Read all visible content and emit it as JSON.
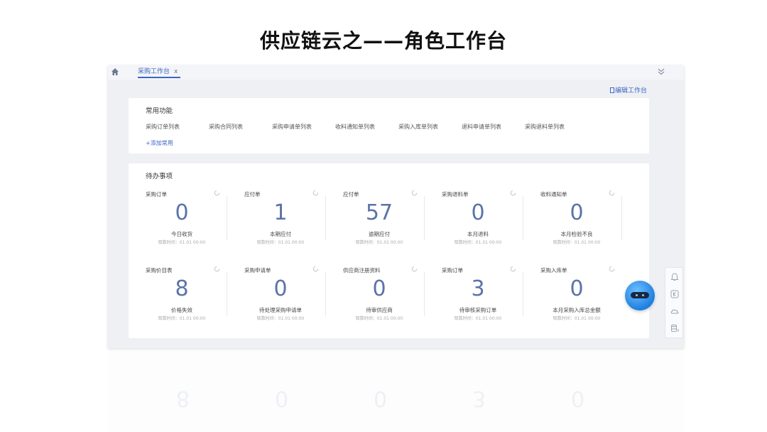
{
  "slide": {
    "title": "供应链云之——角色工作台"
  },
  "tabs": [
    {
      "label": "采购工作台",
      "close": "x"
    }
  ],
  "header": {
    "edit_label": "编辑工作台"
  },
  "frequent": {
    "title": "常用功能",
    "items": [
      "采购订单列表",
      "采购合同列表",
      "采购申请单列表",
      "收料通知单列表",
      "采购入库单列表",
      "退料申请单列表",
      "采购退料单列表"
    ],
    "add_label": "+添加常用"
  },
  "todo": {
    "title": "待办事项",
    "cards": [
      {
        "title": "采购订单",
        "value": "0",
        "label": "今日收货",
        "time": "取数时间：01.01 00:00"
      },
      {
        "title": "应付单",
        "value": "1",
        "label": "本期应付",
        "time": "取数时间：01.01 00:00"
      },
      {
        "title": "应付单",
        "value": "57",
        "label": "逾期应付",
        "time": "取数时间：01.01 00:00"
      },
      {
        "title": "采购退料单",
        "value": "0",
        "label": "本月退料",
        "time": "取数时间：01.01 00:00"
      },
      {
        "title": "收料通知单",
        "value": "0",
        "label": "本月检验不良",
        "time": "取数时间：01.01 00:00"
      },
      {
        "title": "采购价目表",
        "value": "8",
        "label": "价格失效",
        "time": "取数时间：01.01 00:00"
      },
      {
        "title": "采购申请单",
        "value": "0",
        "label": "待处理采购申请单",
        "time": "取数时间：01.01 00:00"
      },
      {
        "title": "供应商注册资料",
        "value": "0",
        "label": "待审供应商",
        "time": "取数时间：01.01 00:00"
      },
      {
        "title": "采购订单",
        "value": "3",
        "label": "待审核采购订单",
        "time": "取数时间：01.01 00:00"
      },
      {
        "title": "采购入库单",
        "value": "0",
        "label": "本月采购入库总金额",
        "time": "取数时间：01.01 00:00"
      }
    ]
  },
  "side_toolbar": {
    "icons": [
      "bell-icon",
      "k-icon",
      "cloud-icon",
      "database-icon"
    ]
  },
  "colors": {
    "accent": "#3d66c4",
    "value": "#5b73a8",
    "background": "#eef0f4"
  }
}
